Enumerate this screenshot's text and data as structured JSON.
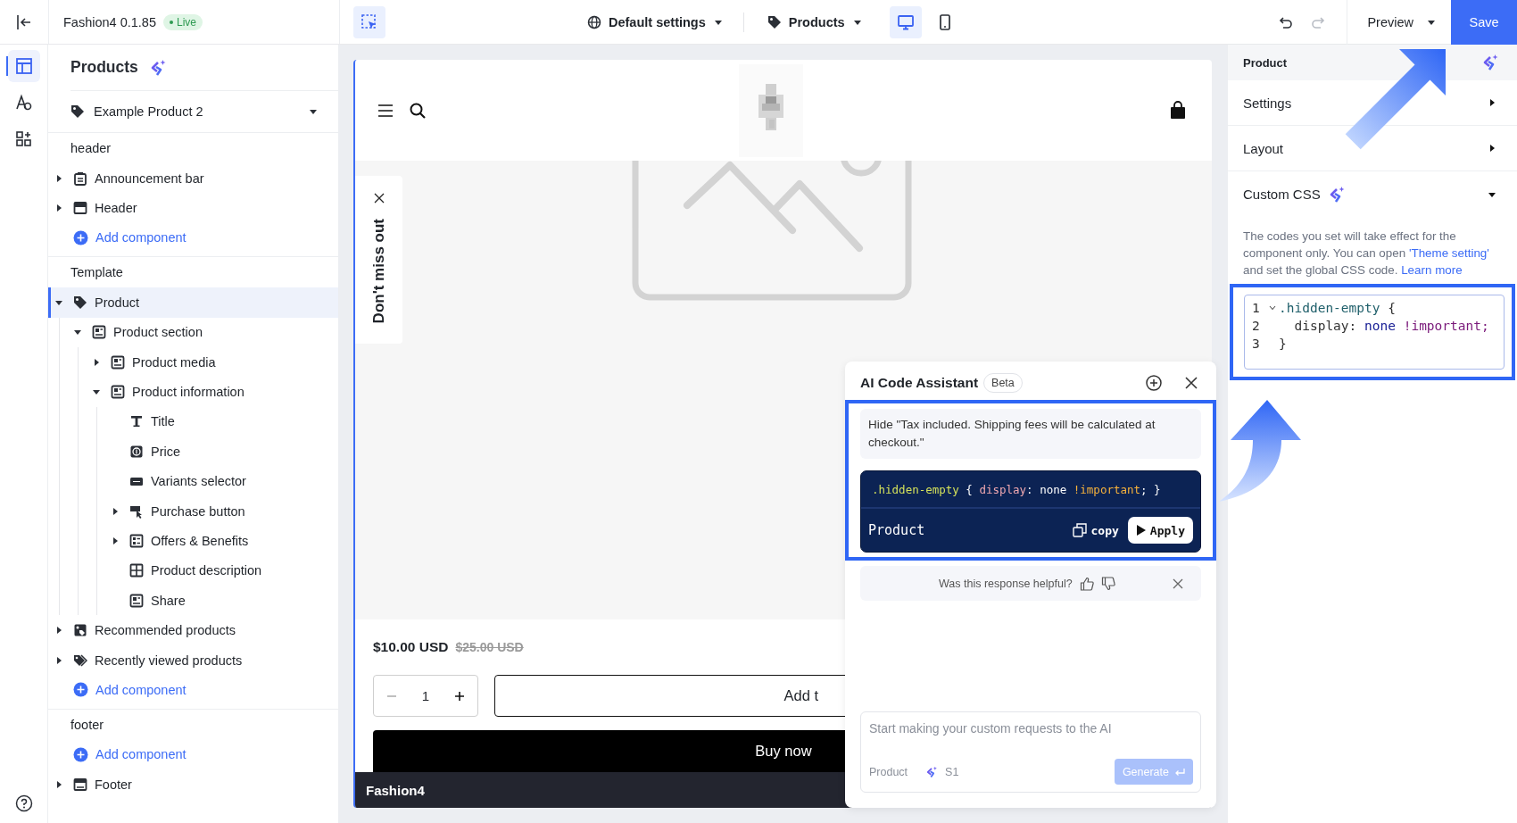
{
  "rail": {
    "items": [
      {
        "kind": "layout",
        "selected": true
      },
      {
        "kind": "theme",
        "selected": false
      },
      {
        "kind": "apps",
        "selected": false
      }
    ]
  },
  "topbar": {
    "title": "Fashion4 0.1.85",
    "badge": "Live",
    "tools": [
      {
        "kind": "select",
        "selected": true
      }
    ],
    "scope": "Default settings",
    "page": "Products",
    "devices": [
      {
        "kind": "desktop",
        "selected": true
      },
      {
        "kind": "mobile",
        "selected": false
      }
    ],
    "history": [
      {
        "kind": "undo",
        "disabled": false
      },
      {
        "kind": "redo",
        "disabled": true
      }
    ],
    "preview": "Preview",
    "save": "Save"
  },
  "sidebar": {
    "title": "Products",
    "product_select": "Example Product 2",
    "sections": [
      {
        "title": "header",
        "items": [
          {
            "kind": "notice",
            "label": "Announcement bar",
            "expanded": false,
            "selected": false
          },
          {
            "kind": "header",
            "label": "Header",
            "expanded": false,
            "selected": false
          },
          {
            "kind": "add",
            "label": "Add component"
          }
        ]
      },
      {
        "title": "Template",
        "items": [
          {
            "kind": "tag",
            "label": "Product",
            "expanded": true,
            "selected": true,
            "children": [
              {
                "kind": "block",
                "label": "Product section",
                "expanded": true,
                "selected": false,
                "children": [
                  {
                    "kind": "block",
                    "label": "Product media",
                    "expanded": false,
                    "selected": false
                  },
                  {
                    "kind": "block",
                    "label": "Product information",
                    "expanded": true,
                    "selected": false,
                    "children": [
                      {
                        "kind": "text",
                        "label": "Title",
                        "selected": false
                      },
                      {
                        "kind": "price",
                        "label": "Price",
                        "selected": false
                      },
                      {
                        "kind": "sku",
                        "label": "Variants selector",
                        "selected": false
                      },
                      {
                        "kind": "cursor",
                        "label": "Purchase button",
                        "expanded": false,
                        "selected": false
                      },
                      {
                        "kind": "list",
                        "label": "Offers & Benefits",
                        "expanded": false,
                        "selected": false
                      },
                      {
                        "kind": "grid",
                        "label": "Product description",
                        "selected": false
                      },
                      {
                        "kind": "block",
                        "label": "Share",
                        "selected": false
                      }
                    ]
                  }
                ]
              }
            ]
          },
          {
            "kind": "gallery",
            "label": "Recommended products",
            "expanded": false,
            "selected": false
          },
          {
            "kind": "tags",
            "label": "Recently viewed products",
            "expanded": false,
            "selected": false
          },
          {
            "kind": "add",
            "label": "Add component"
          }
        ]
      },
      {
        "title": "footer",
        "items": [
          {
            "kind": "add",
            "label": "Add component"
          },
          {
            "kind": "footer",
            "label": "Footer",
            "expanded": false,
            "selected": false
          }
        ]
      }
    ]
  },
  "preview": {
    "popup": "Don't miss out",
    "price": "$10.00 USD",
    "compare_price": "$25.00 USD",
    "quantity": "1",
    "add_button": "Add t",
    "buy_button": "Buy now",
    "footer_brand": "Fashion4"
  },
  "assistant": {
    "title": "AI Code Assistant",
    "badge": "Beta",
    "prompt": "Hide \"Tax included. Shipping fees will be calculated at checkout.\"",
    "answer": {
      "tokens": [
        {
          "text": ".hidden-empty",
          "kind": "selector"
        },
        {
          "text": " { ",
          "kind": "plain"
        },
        {
          "text": "display",
          "kind": "property"
        },
        {
          "text": ": none ",
          "kind": "plain"
        },
        {
          "text": "!important",
          "kind": "important"
        },
        {
          "text": "; }",
          "kind": "plain"
        }
      ],
      "scope": "Product",
      "copy": "copy",
      "apply": "Apply"
    },
    "feedback": "Was this response helpful?",
    "input": {
      "placeholder": "Start making your custom requests to the AI",
      "scope": "Product",
      "version": "S1",
      "generate": "Generate",
      "generate_disabled": true
    }
  },
  "panel": {
    "title": "Product",
    "groups": [
      {
        "label": "Settings",
        "ai_icon": false,
        "expanded": false
      },
      {
        "label": "Layout",
        "ai_icon": false,
        "expanded": false
      },
      {
        "label": "Custom CSS",
        "ai_icon": true,
        "expanded": true,
        "note": [
          {
            "kind": "text",
            "text": "The codes you set will take effect for the component only. You can open "
          },
          {
            "kind": "link",
            "text": "'Theme setting'"
          },
          {
            "kind": "text",
            "text": " and set the global CSS code. "
          },
          {
            "kind": "link",
            "text": "Learn more"
          }
        ],
        "code": [
          {
            "number": "1",
            "fold": true,
            "tokens": [
              {
                "text": ".hidden-empty",
                "kind": "selector"
              },
              {
                "text": " {",
                "kind": "plain"
              }
            ]
          },
          {
            "number": "2",
            "fold": false,
            "tokens": [
              {
                "text": "  display: ",
                "kind": "property"
              },
              {
                "text": "none",
                "kind": "value"
              },
              {
                "text": " !important;",
                "kind": "important"
              }
            ]
          },
          {
            "number": "3",
            "fold": false,
            "tokens": [
              {
                "text": "}",
                "kind": "plain"
              }
            ]
          }
        ]
      }
    ]
  }
}
